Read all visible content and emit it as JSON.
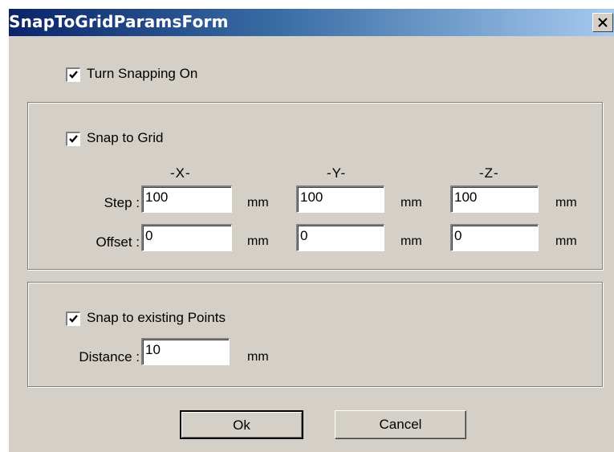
{
  "window": {
    "title": "SnapToGridParamsForm",
    "close_label": "X"
  },
  "turn_snapping": {
    "label": "Turn Snapping On",
    "checked": true
  },
  "grid_group": {
    "snap_to_grid": {
      "label": "Snap to Grid",
      "checked": true
    },
    "axes": {
      "x": "-X-",
      "y": "-Y-",
      "z": "-Z-"
    },
    "step": {
      "label": "Step :",
      "x": "100",
      "y": "100",
      "z": "100",
      "unit": "mm"
    },
    "offset": {
      "label": "Offset :",
      "x": "0",
      "y": "0",
      "z": "0",
      "unit": "mm"
    }
  },
  "points_group": {
    "snap_to_points": {
      "label": "Snap to existing Points",
      "checked": true
    },
    "distance": {
      "label": "Distance :",
      "value": "10",
      "unit": "mm"
    }
  },
  "buttons": {
    "ok": "Ok",
    "cancel": "Cancel"
  },
  "colors": {
    "face": "#d4d0c8",
    "title_start": "#0a246a",
    "title_end": "#a6caf0"
  }
}
